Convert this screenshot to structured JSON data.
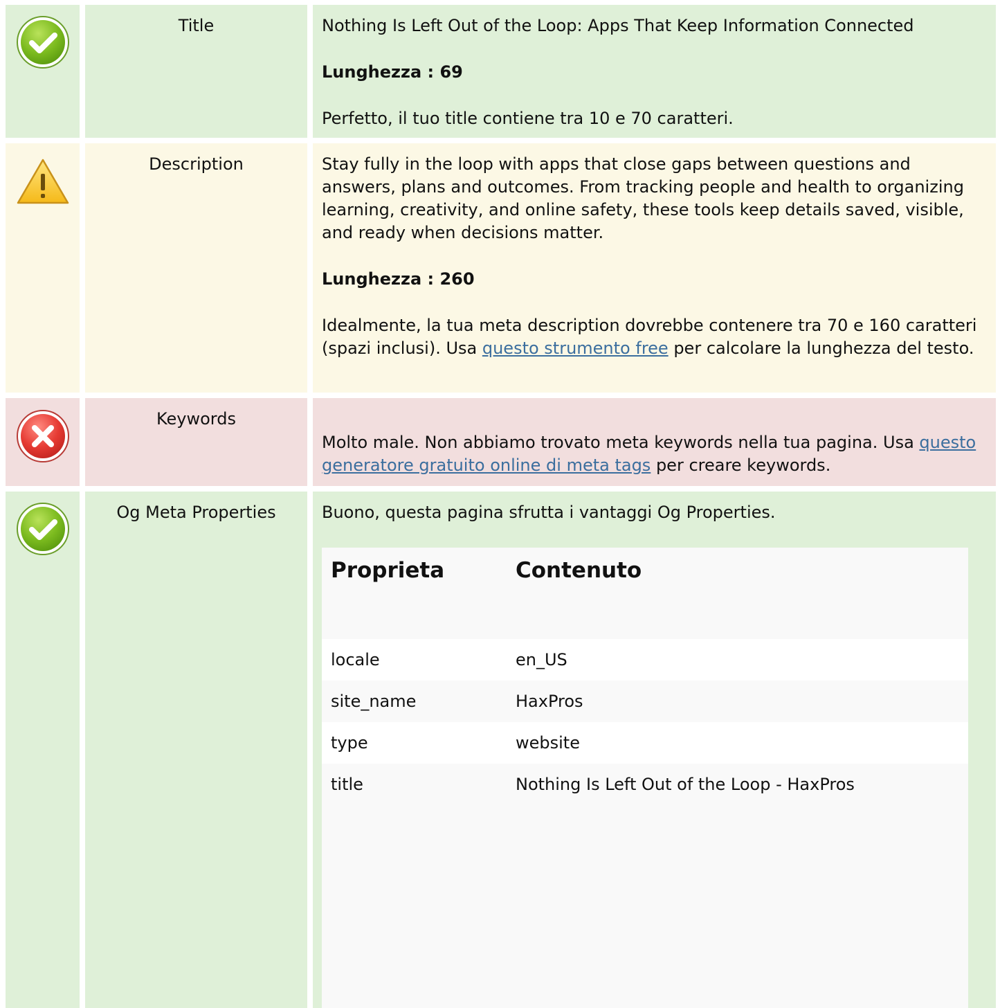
{
  "rows": {
    "title": {
      "status": "good",
      "icon": "check-circle-icon",
      "label": "Title",
      "value": "Nothing Is Left Out of the Loop: Apps That Keep Information Connected",
      "length_text": "Lunghezza : 69",
      "note": "Perfetto, il tuo title contiene tra 10 e 70 caratteri."
    },
    "description": {
      "status": "warning",
      "icon": "warning-triangle-icon",
      "label": "Description",
      "value": "Stay fully in the loop with apps that close gaps between questions and answers, plans and outcomes. From tracking people and health to organizing learning, creativity, and online safety, these tools keep details saved, visible, and ready when decisions matter.",
      "length_text": "Lunghezza : 260",
      "note_before": "Idealmente, la tua meta description dovrebbe contenere tra 70 e 160 caratteri (spazi inclusi). Usa ",
      "note_link": "questo strumento free",
      "note_after": " per calcolare la lunghezza del testo."
    },
    "keywords": {
      "status": "bad",
      "icon": "error-cross-icon",
      "label": "Keywords",
      "note_before": "Molto male. Non abbiamo trovato meta keywords nella tua pagina. Usa ",
      "note_link": "questo generatore gratuito online di meta tags",
      "note_after": " per creare keywords."
    },
    "og": {
      "status": "good",
      "icon": "check-circle-icon",
      "label": "Og Meta Properties",
      "note": "Buono, questa pagina sfrutta i vantaggi Og Properties.",
      "table": {
        "headers": [
          "Proprieta",
          "Contenuto"
        ],
        "rows": [
          [
            "locale",
            "en_US"
          ],
          [
            "site_name",
            "HaxPros"
          ],
          [
            "type",
            "website"
          ],
          [
            "title",
            "Nothing Is Left Out of the Loop - HaxPros"
          ]
        ]
      }
    }
  },
  "colors": {
    "good": "#dff0d8",
    "warning": "#fcf8e5",
    "bad": "#f2dede",
    "link": "#3b6e9e"
  }
}
